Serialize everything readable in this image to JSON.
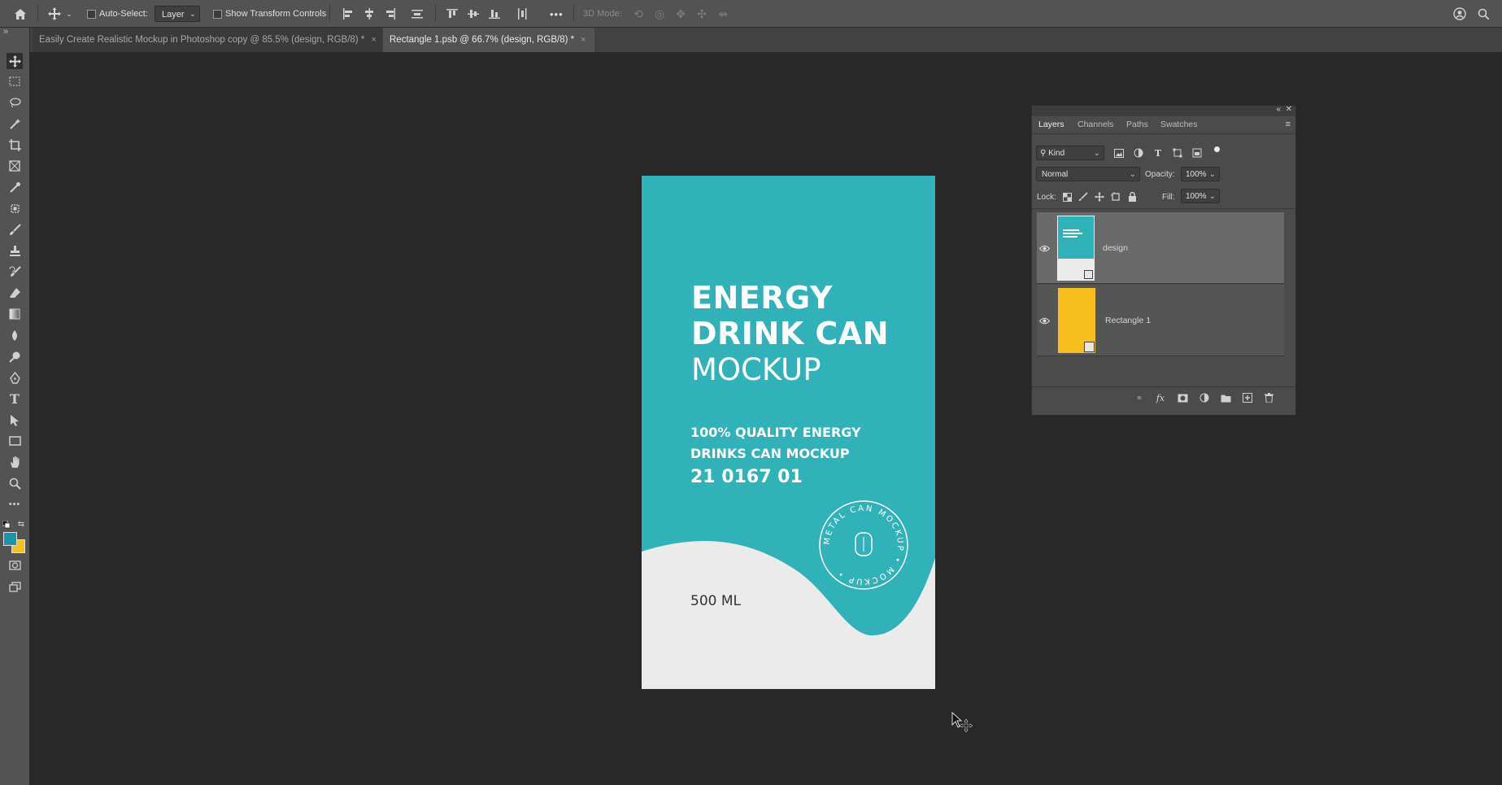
{
  "options_bar": {
    "auto_select_label": "Auto-Select:",
    "layer_dropdown": "Layer",
    "show_transform_label": "Show Transform Controls",
    "more_label": "•••",
    "mode_3d_label": "3D Mode:"
  },
  "tabs": [
    {
      "label": "Easily Create Realistic Mockup in Photoshop copy @ 85.5% (design, RGB/8) *",
      "close": "×"
    },
    {
      "label": "Rectangle 1.psb @ 66.7% (design, RGB/8) *",
      "close": "×"
    }
  ],
  "toolbar": {
    "expand_label": "»",
    "more_tools": "•••",
    "foreground_color": "#1597a8",
    "background_color": "#f5c21b"
  },
  "artboard": {
    "bg_color": "#30b2b8",
    "bottom_color": "#ebebeb",
    "title_line1": "ENERGY",
    "title_line2": "DRINK CAN",
    "title_line3": "MOCKUP",
    "subtitle_line1": "100% QUALITY ENERGY",
    "subtitle_line2": "DRINKS CAN MOCKUP",
    "code": "21 0167 01",
    "volume": "500 ML",
    "badge_text": "METAL CAN MOCKUP • MOCKUP •"
  },
  "layers_panel": {
    "tabs": [
      "Layers",
      "Channels",
      "Paths",
      "Swatches"
    ],
    "filter_label": "Kind",
    "blend_mode": "Normal",
    "opacity_label": "Opacity:",
    "opacity_value": "100%",
    "lock_label": "Lock:",
    "fill_label": "Fill:",
    "fill_value": "100%",
    "layers": [
      {
        "name": "design",
        "selected": true,
        "thumb_color": "#30b2b8"
      },
      {
        "name": "Rectangle 1",
        "selected": false,
        "thumb_color": "#f6bf1e"
      }
    ]
  }
}
